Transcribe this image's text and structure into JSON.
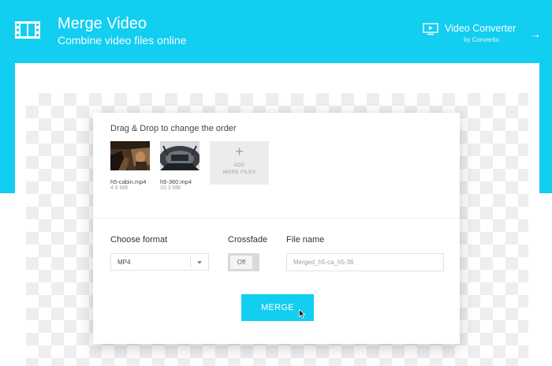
{
  "header": {
    "title": "Merge Video",
    "subtitle": "Combine video files online",
    "brand_name": "Video Converter",
    "brand_by": "by Convertio",
    "icons": {
      "app": "film-strip-icon",
      "brand": "monitor-play-icon",
      "brand_arrow": "arrow-right-icon"
    }
  },
  "colors": {
    "accent": "#12cef0",
    "checker": "#eceef0",
    "card": "#ffffff"
  },
  "files": {
    "instruction": "Drag & Drop to change the order",
    "items": [
      {
        "name": "h5-cabin.mp4",
        "size": "4.6 MB"
      },
      {
        "name": "h5-360.mp4",
        "size": "10.3 MB"
      }
    ],
    "add_button": {
      "plus": "+",
      "line1": "ADD",
      "line2": "MORE FILES"
    }
  },
  "options": {
    "format_label": "Choose format",
    "format_value": "MP4",
    "crossfade_label": "Crossfade",
    "crossfade_state": "Off",
    "filename_label": "File name",
    "filename_placeholder": "Merged_h5-ca_h5-36"
  },
  "actions": {
    "merge_label": "MERGE"
  }
}
